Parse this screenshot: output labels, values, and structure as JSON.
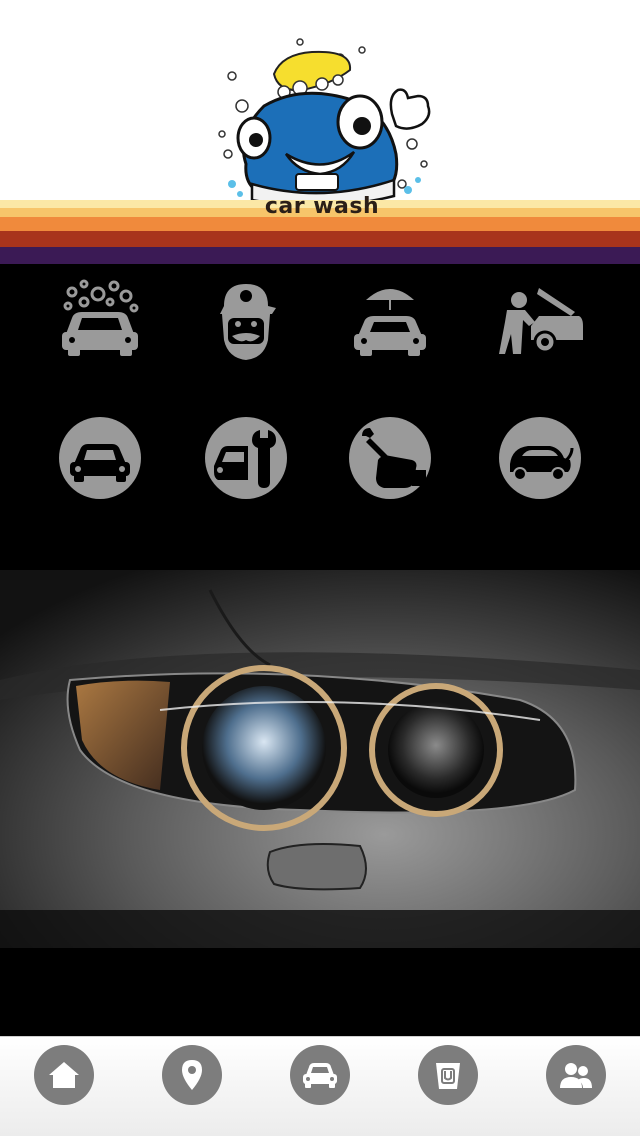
{
  "header": {
    "logo_text": "car wash"
  },
  "services": [
    {
      "icon": "car-wash-bubbles-icon"
    },
    {
      "icon": "mechanic-face-icon"
    },
    {
      "icon": "car-umbrella-icon"
    },
    {
      "icon": "car-repair-hood-icon"
    },
    {
      "icon": "car-circle-icon"
    },
    {
      "icon": "car-wrench-circle-icon"
    },
    {
      "icon": "hand-wrench-circle-icon"
    },
    {
      "icon": "car-plug-circle-icon"
    }
  ],
  "tabbar": [
    {
      "icon": "home-icon"
    },
    {
      "icon": "location-pin-icon"
    },
    {
      "icon": "car-icon"
    },
    {
      "icon": "coupon-bucket-icon"
    },
    {
      "icon": "users-icon"
    }
  ],
  "colors": {
    "icon_gray": "#9a9a9a",
    "tab_gray": "#7d7d7d",
    "stripe_cream": "#fbe8a6",
    "stripe_yellow": "#f7c56a",
    "stripe_orange": "#f08a3c",
    "stripe_rust": "#a8341c",
    "stripe_purple": "#3b1a55"
  }
}
